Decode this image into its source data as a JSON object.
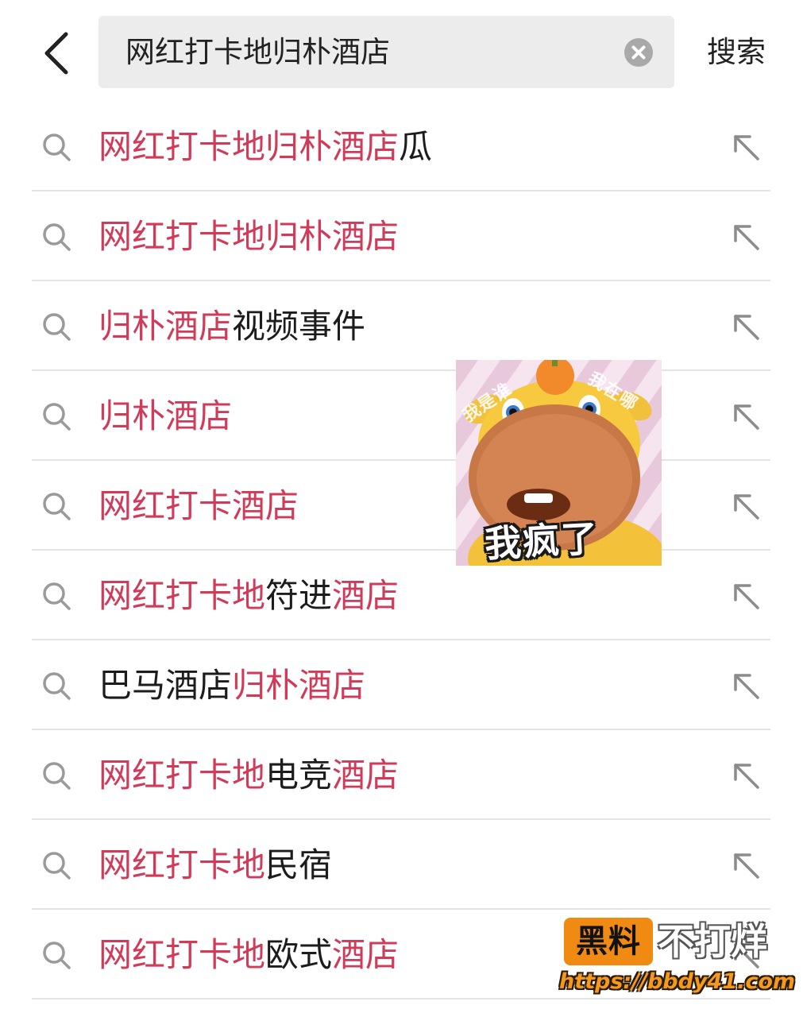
{
  "header": {
    "query": "网红打卡地归朴酒店",
    "search_label": "搜索"
  },
  "colors": {
    "highlight": "#cf3b58",
    "text": "#1c1c1c",
    "search_box_bg": "#ececec"
  },
  "suggestions": [
    {
      "parts": [
        {
          "text": "网红打卡地归朴酒店",
          "highlight": true
        },
        {
          "text": "瓜",
          "highlight": false
        }
      ]
    },
    {
      "parts": [
        {
          "text": "网红打卡地归朴酒店",
          "highlight": true
        }
      ]
    },
    {
      "parts": [
        {
          "text": "归朴酒店",
          "highlight": true
        },
        {
          "text": "视频事件",
          "highlight": false
        }
      ]
    },
    {
      "parts": [
        {
          "text": "归朴酒店",
          "highlight": true
        }
      ]
    },
    {
      "parts": [
        {
          "text": "网红打卡酒店",
          "highlight": true
        }
      ]
    },
    {
      "parts": [
        {
          "text": "网红打卡地",
          "highlight": true
        },
        {
          "text": "符进",
          "highlight": false
        },
        {
          "text": "酒店",
          "highlight": true
        }
      ]
    },
    {
      "parts": [
        {
          "text": "巴马酒店",
          "highlight": false
        },
        {
          "text": "归朴酒店",
          "highlight": true
        }
      ]
    },
    {
      "parts": [
        {
          "text": "网红打卡地",
          "highlight": true
        },
        {
          "text": "电竞",
          "highlight": false
        },
        {
          "text": "酒店",
          "highlight": true
        }
      ]
    },
    {
      "parts": [
        {
          "text": "网红打卡地",
          "highlight": true
        },
        {
          "text": "民宿",
          "highlight": false
        }
      ]
    },
    {
      "parts": [
        {
          "text": "网红打卡地",
          "highlight": true
        },
        {
          "text": "欧式",
          "highlight": false
        },
        {
          "text": "酒店",
          "highlight": true
        }
      ]
    }
  ],
  "sticker": {
    "caption": "我疯了",
    "corner_left": "我是谁",
    "corner_right": "我在哪"
  },
  "watermark": {
    "badge": "黑料",
    "text": "不打烊",
    "url": "https://bbdy41.com"
  }
}
